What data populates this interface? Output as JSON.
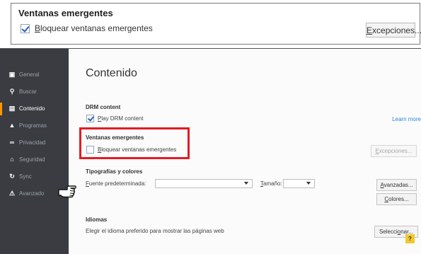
{
  "top_panel": {
    "title": "Ventanas emergentes",
    "checkbox_label_u": "B",
    "checkbox_label_rest": "loquear ventanas emergentes",
    "checkbox_checked": true,
    "exceptions_u": "E",
    "exceptions_rest": "xcepciones..."
  },
  "sidebar": {
    "items": [
      {
        "label": "General",
        "icon": "general-icon",
        "glyph": "▣"
      },
      {
        "label": "Buscar",
        "icon": "search-icon",
        "glyph": "⚲"
      },
      {
        "label": "Contenido",
        "icon": "content-icon",
        "glyph": "▤",
        "active": true
      },
      {
        "label": "Programas",
        "icon": "applications-icon",
        "glyph": "▲"
      },
      {
        "label": "Privacidad",
        "icon": "privacy-icon",
        "glyph": "∞"
      },
      {
        "label": "Seguridad",
        "icon": "security-icon",
        "glyph": "⌂"
      },
      {
        "label": "Sync",
        "icon": "sync-icon",
        "glyph": "↻"
      },
      {
        "label": "Avanzado",
        "icon": "advanced-icon",
        "glyph": "⚠"
      }
    ]
  },
  "content": {
    "title": "Contenido",
    "drm": {
      "title": "DRM content",
      "checkbox_u": "P",
      "checkbox_rest": "lay DRM content",
      "checked": true,
      "learn_more": "Learn more"
    },
    "popups": {
      "title": "Ventanas emergentes",
      "checkbox_u": "B",
      "checkbox_rest": "loquear ventanas emergentes",
      "checked": false,
      "exceptions_u": "E",
      "exceptions_rest": "xcepciones..."
    },
    "fonts": {
      "title": "Tipografías y colores",
      "default_font_u": "F",
      "default_font_rest": "uente predeterminada:",
      "default_font_value": "",
      "size_u": "T",
      "size_rest": "amaño:",
      "size_value": "",
      "advanced_u": "A",
      "advanced_rest": "vanzadas...",
      "colors_u": "C",
      "colors_rest": "olores..."
    },
    "languages": {
      "title": "Idiomas",
      "description": "Elegir el idioma preferido para mostrar las páginas web",
      "choose_u": "o",
      "choose_pre": "Selecci",
      "choose_post": "nar..."
    },
    "help_glyph": "?"
  },
  "colors": {
    "highlight": "#e31b23",
    "sidebar_bg": "#3a3c42",
    "active_accent": "#ff9500",
    "link": "#2b88d8"
  }
}
